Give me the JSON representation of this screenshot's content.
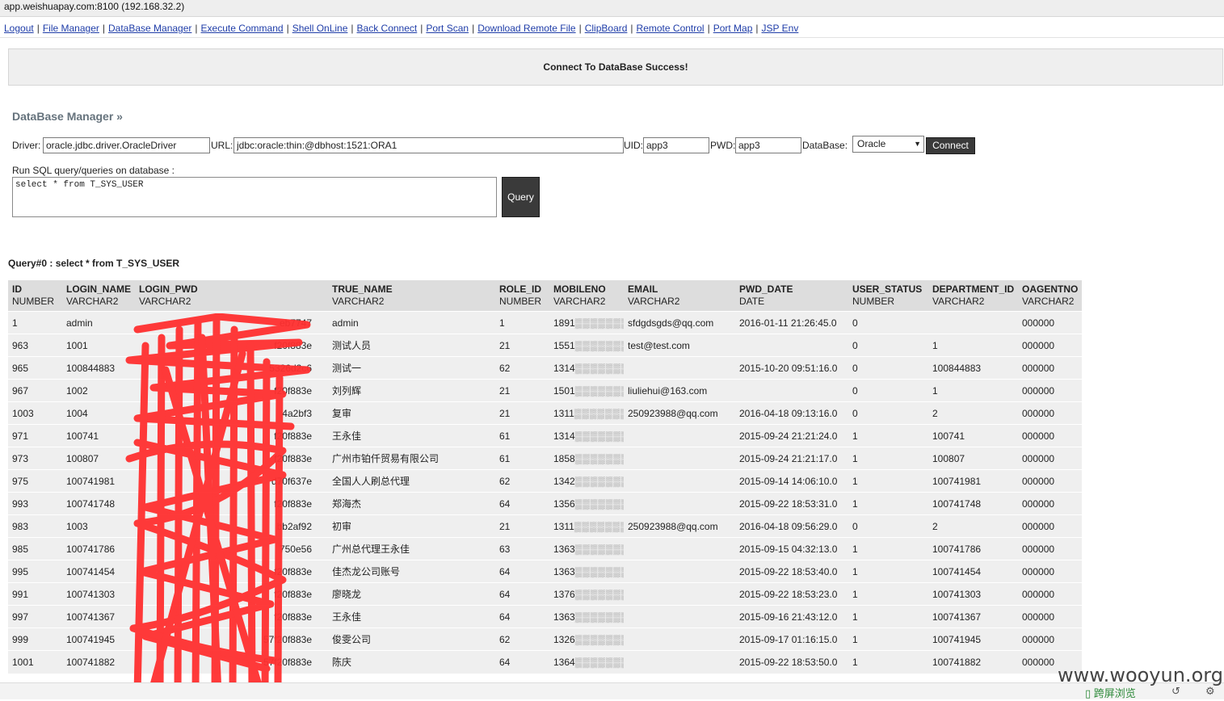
{
  "host": "app.weishuapay.com:8100 (192.168.32.2)",
  "nav": [
    "Logout",
    "File Manager",
    "DataBase Manager",
    "Execute Command",
    "Shell OnLine",
    "Back Connect",
    "Port Scan",
    "Download Remote File",
    "ClipBoard",
    "Remote Control",
    "Port Map",
    "JSP Env"
  ],
  "status_message": "Connect To DataBase Success!",
  "section_title": "DataBase Manager »",
  "connection": {
    "driver_label": "Driver:",
    "driver_value": "oracle.jdbc.driver.OracleDriver",
    "url_label": "URL:",
    "url_value": "jdbc:oracle:thin:@dbhost:1521:ORA1",
    "uid_label": "UID:",
    "uid_value": "app3",
    "pwd_label": "PWD:",
    "pwd_value": "app3",
    "database_label": "DataBase:",
    "database_value": "Oracle",
    "connect_label": "Connect"
  },
  "sql": {
    "label": "Run SQL query/queries on database :",
    "query_text": "select * from T_SYS_USER",
    "query_button": "Query"
  },
  "query_title": "Query#0 : select * from T_SYS_USER",
  "table": {
    "columns": [
      {
        "name": "ID",
        "type": "NUMBER"
      },
      {
        "name": "LOGIN_NAME",
        "type": "VARCHAR2"
      },
      {
        "name": "LOGIN_PWD",
        "type": "VARCHAR2"
      },
      {
        "name": "TRUE_NAME",
        "type": "VARCHAR2"
      },
      {
        "name": "ROLE_ID",
        "type": "NUMBER"
      },
      {
        "name": "MOBILENO",
        "type": "VARCHAR2"
      },
      {
        "name": "EMAIL",
        "type": "VARCHAR2"
      },
      {
        "name": "PWD_DATE",
        "type": "DATE"
      },
      {
        "name": "USER_STATUS",
        "type": "NUMBER"
      },
      {
        "name": "DEPARTMENT_ID",
        "type": "VARCHAR2"
      },
      {
        "name": "OAGENTNO",
        "type": "VARCHAR2"
      }
    ],
    "rows": [
      [
        "1",
        "admin",
        "eb7747",
        "admin",
        "1",
        "1891",
        "sfdgdsgds@qq.com",
        "2016-01-11 21:26:45.0",
        "0",
        "",
        "000000"
      ],
      [
        "963",
        "1001",
        "f20f883e",
        "测试人员",
        "21",
        "1551",
        "test@test.com",
        "",
        "0",
        "1",
        "000000"
      ],
      [
        "965",
        "100844883",
        "5326d2c6",
        "测试一",
        "62",
        "1314",
        "",
        "2015-10-20 09:51:16.0",
        "0",
        "100844883",
        "000000"
      ],
      [
        "967",
        "1002",
        "f20f883e",
        "刘列辉",
        "21",
        "1501",
        "liuliehui@163.com",
        "",
        "0",
        "1",
        "000000"
      ],
      [
        "1003",
        "1004",
        "4a2bf3",
        "复审",
        "21",
        "1311",
        "250923988@qq.com",
        "2016-04-18 09:13:16.0",
        "0",
        "2",
        "000000"
      ],
      [
        "971",
        "100741",
        "f20f883e",
        "王永佳",
        "61",
        "1314",
        "",
        "2015-09-24 21:21:24.0",
        "1",
        "100741",
        "000000"
      ],
      [
        "973",
        "100807",
        "f20f883e",
        "广州市铂仟贸易有限公司",
        "61",
        "1858",
        "",
        "2015-09-24 21:21:17.0",
        "1",
        "100807",
        "000000"
      ],
      [
        "975",
        "100741981",
        "d70f637e",
        "全国人人刷总代理",
        "62",
        "1342",
        "",
        "2015-09-14 14:06:10.0",
        "1",
        "100741981",
        "000000"
      ],
      [
        "993",
        "100741748",
        "f20f883e",
        "郑海杰",
        "64",
        "1356",
        "",
        "2015-09-22 18:53:31.0",
        "1",
        "100741748",
        "000000"
      ],
      [
        "983",
        "1003",
        "bb2af92",
        "初审",
        "21",
        "1311",
        "250923988@qq.com",
        "2016-04-18 09:56:29.0",
        "0",
        "2",
        "000000"
      ],
      [
        "985",
        "100741786",
        "750e56",
        "广州总代理王永佳",
        "63",
        "1363",
        "",
        "2015-09-15 04:32:13.0",
        "1",
        "100741786",
        "000000"
      ],
      [
        "995",
        "100741454",
        "f20f883e",
        "佳杰龙公司账号",
        "64",
        "1363",
        "",
        "2015-09-22 18:53:40.0",
        "1",
        "100741454",
        "000000"
      ],
      [
        "991",
        "100741303",
        "f20f883e",
        "廖晓龙",
        "64",
        "1376",
        "",
        "2015-09-22 18:53:23.0",
        "1",
        "100741303",
        "000000"
      ],
      [
        "997",
        "100741367",
        "f20f883e",
        "王永佳",
        "64",
        "1363",
        "",
        "2015-09-16 21:43:12.0",
        "1",
        "100741367",
        "000000"
      ],
      [
        "999",
        "100741945",
        "57f20f883e",
        "俊雯公司",
        "62",
        "1326",
        "",
        "2015-09-17 01:16:15.0",
        "1",
        "100741945",
        "000000"
      ],
      [
        "1001",
        "100741882",
        "57f20f883e",
        "陈庆",
        "64",
        "1364",
        "",
        "2015-09-22 18:53:50.0",
        "1",
        "100741882",
        "000000"
      ]
    ]
  },
  "watermark": "www.wooyun.org",
  "footer": {
    "status_text": "跨屏浏览"
  },
  "colors": {
    "link": "#1f3da8",
    "scribble": "#ff3030",
    "header_bg": "#dddddd",
    "row_bg": "#efefef"
  }
}
